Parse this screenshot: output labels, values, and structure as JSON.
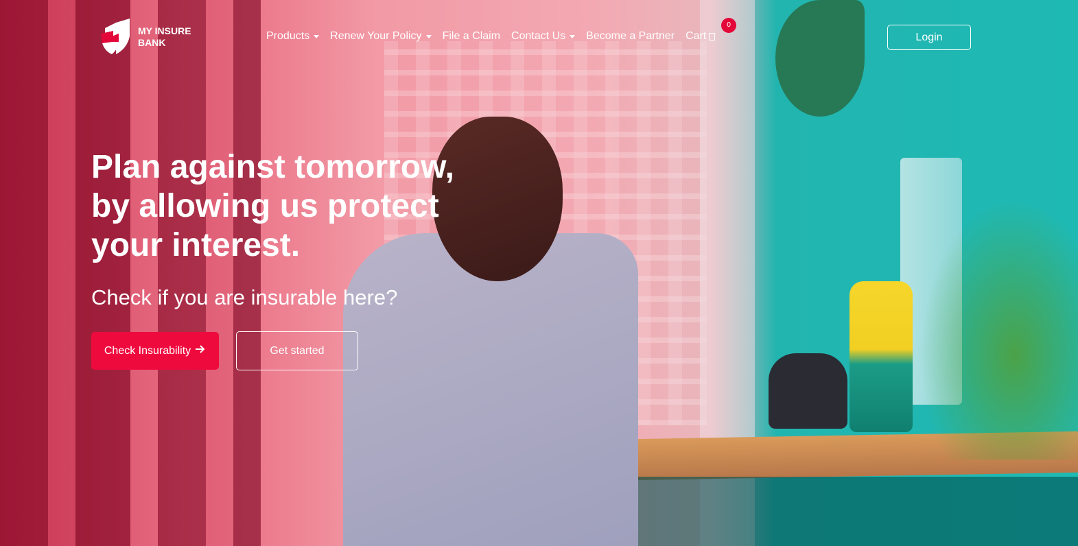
{
  "brand": {
    "name": "MY INSURE BANK",
    "name_line1": "MY INSURE",
    "name_line2": "BANK",
    "accent_color": "#ef0a3e"
  },
  "nav": {
    "items": [
      {
        "label": "Products",
        "has_dropdown": true
      },
      {
        "label": "Renew Your Policy",
        "has_dropdown": true
      },
      {
        "label": "File a Claim",
        "has_dropdown": false
      },
      {
        "label": "Contact Us",
        "has_dropdown": true
      },
      {
        "label": "Become a Partner",
        "has_dropdown": false
      }
    ],
    "cart_label": "Cart",
    "cart_count": "0",
    "cart_icon": "cart-icon"
  },
  "header": {
    "login_label": "Login"
  },
  "hero": {
    "headline": "Plan against tomorrow, by allowing us protect your interest.",
    "subheadline": "Check if you are insurable here?",
    "primary_button": "Check Insurability",
    "primary_button_icon": "arrow-right-icon",
    "secondary_button": "Get started"
  }
}
